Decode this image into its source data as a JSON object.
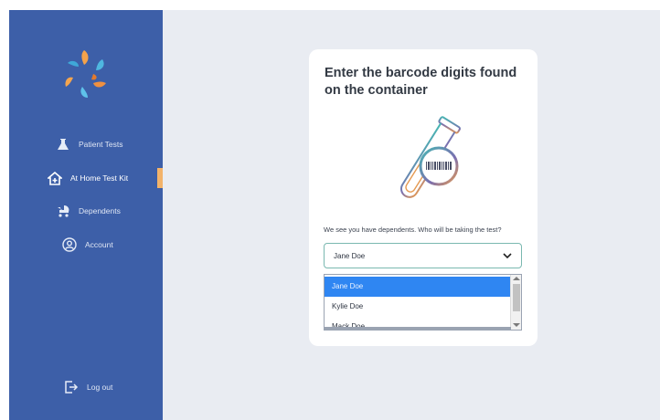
{
  "sidebar": {
    "items": [
      {
        "label": "Patient Tests",
        "icon": "flask-icon"
      },
      {
        "label": "At Home Test Kit",
        "icon": "house-plus-icon",
        "active": true
      },
      {
        "label": "Dependents",
        "icon": "stroller-icon"
      },
      {
        "label": "Account",
        "icon": "user-circle-icon"
      }
    ],
    "logout_label": "Log out"
  },
  "card": {
    "title": "Enter the barcode digits found on the container",
    "prompt": "We see you have dependents. Who will be taking the test?",
    "select_value": "Jane Doe",
    "options": [
      "Jane Doe",
      "Kylie Doe",
      "Mack Doe"
    ]
  },
  "colors": {
    "sidebar_bg": "#3d5fa8",
    "active_indicator": "#f3b36a",
    "selected_option": "#2f86f2",
    "select_border": "#7ab8b0"
  }
}
